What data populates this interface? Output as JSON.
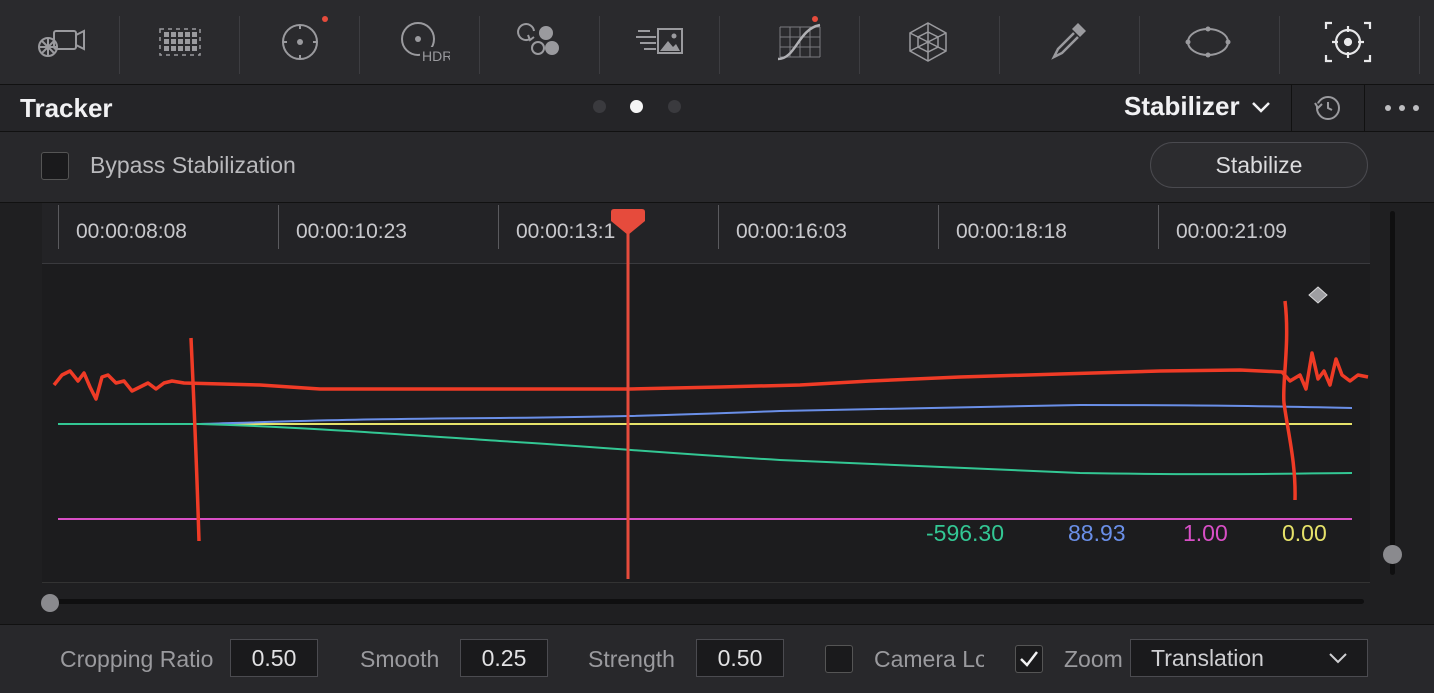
{
  "colors": {
    "playhead": "#e64b3c",
    "curve_green": "#33c794",
    "curve_blue": "#6a8fe8",
    "curve_magenta": "#d84fc6",
    "curve_yellow": "#e6e26a",
    "annotation": "#ef3b26"
  },
  "toolbar": {
    "tools": [
      {
        "icon": "camera-raw-icon",
        "badge": false
      },
      {
        "icon": "color-match-icon",
        "badge": false
      },
      {
        "icon": "color-wheels-icon",
        "badge": true
      },
      {
        "icon": "hdr-wheels-icon",
        "badge": false,
        "label": "HDR"
      },
      {
        "icon": "rgb-mixer-icon",
        "badge": false
      },
      {
        "icon": "motion-effects-icon",
        "badge": false
      },
      {
        "icon": "curves-icon",
        "badge": true
      },
      {
        "icon": "color-warper-icon",
        "badge": false
      },
      {
        "icon": "qualifier-icon",
        "badge": false
      },
      {
        "icon": "window-icon",
        "badge": false
      },
      {
        "icon": "tracker-icon",
        "badge": false,
        "active": true
      }
    ]
  },
  "header": {
    "title": "Tracker",
    "page_dots": 3,
    "active_dot": 1,
    "mode": "Stabilizer"
  },
  "bypass": {
    "label": "Bypass Stabilization",
    "checked": false,
    "button": "Stabilize"
  },
  "timeline": {
    "timecodes": [
      "00:00:08:08",
      "00:00:10:23",
      "00:00:13:1",
      "00:00:16:03",
      "00:00:18:18",
      "00:00:21:09"
    ]
  },
  "curve_values": {
    "green": "-596.30",
    "blue": "88.93",
    "magenta": "1.00",
    "yellow": "0.00"
  },
  "controls": {
    "cropping_ratio_label": "Cropping Ratio",
    "cropping_ratio_value": "0.50",
    "smooth_label": "Smooth",
    "smooth_value": "0.25",
    "strength_label": "Strength",
    "strength_value": "0.50",
    "camera_lock_label": "Camera Lock",
    "camera_lock_checked": false,
    "zoom_label": "Zoom",
    "zoom_checked": true,
    "mode_dropdown": "Translation"
  }
}
